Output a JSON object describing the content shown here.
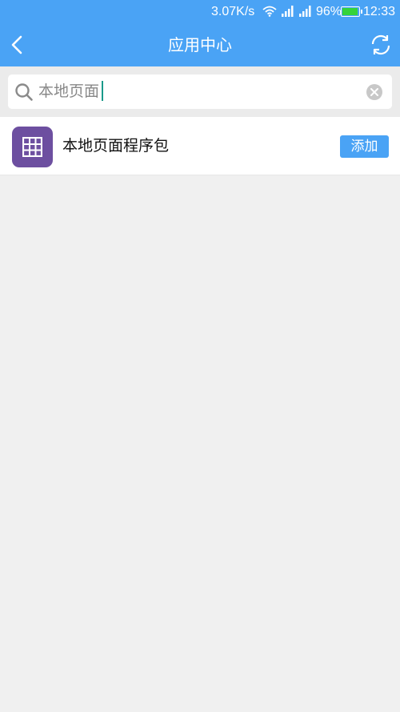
{
  "status_bar": {
    "net_speed": "3.07K/s",
    "battery_percent": "96%",
    "battery_level": 0.96,
    "time": "12:33",
    "icons": [
      "wifi-icon",
      "signal-icon",
      "signal-icon",
      "battery-icon"
    ]
  },
  "header": {
    "title": "应用中心",
    "back_icon": "chevron-left-icon",
    "refresh_icon": "refresh-icon"
  },
  "search": {
    "value": "本地页面",
    "search_icon": "search-icon",
    "clear_icon": "clear-icon"
  },
  "apps": [
    {
      "name": "本地页面程序包",
      "icon": "table-grid-icon",
      "icon_color": "#6d4fa0",
      "action_label": "添加"
    }
  ],
  "colors": {
    "accent": "#4aa3f5",
    "background": "#f0f0f0",
    "battery_fill": "#35d33a"
  }
}
